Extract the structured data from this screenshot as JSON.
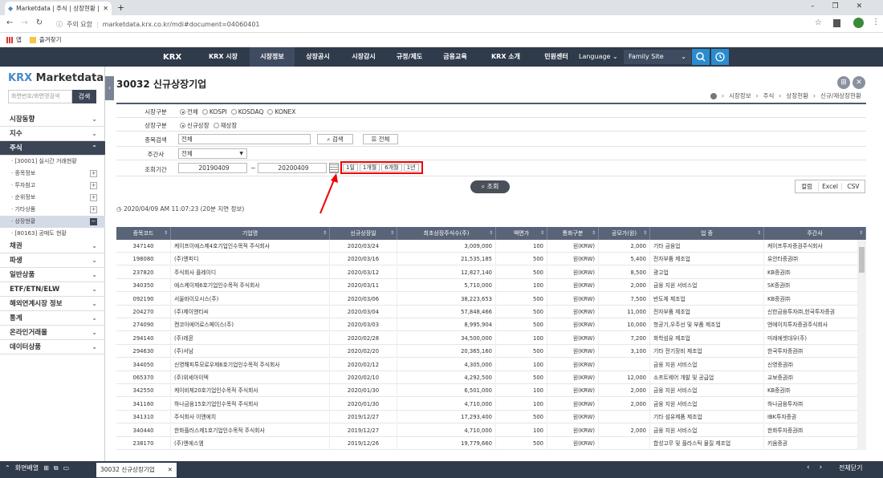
{
  "browser": {
    "tab_title": "Marketdata | 주식 | 상장현황 | 전",
    "security_label": "주의 요함",
    "url": "marketdata.krx.co.kr/mdi#document=04060401",
    "bookmarks": [
      "앱",
      "즐겨찾기"
    ]
  },
  "topnav": {
    "logo": "KRX",
    "items": [
      "KRX 시장",
      "시장정보",
      "상장공시",
      "시장감시",
      "규정/제도",
      "금융교육",
      "KRX 소개",
      "민원센터"
    ],
    "language": "Language",
    "family_site": "Family Site"
  },
  "sidebar": {
    "brand_prefix": "KRX",
    "brand_suffix": "Marketdata",
    "search_placeholder": "화면번호/화면명검색",
    "search_button": "검색",
    "menu": [
      "시장동향",
      "지수",
      "주식",
      "채권",
      "파생",
      "일반상품",
      "ETF/ETN/ELW",
      "해외연계시장 정보",
      "통계",
      "온라인거래몰",
      "데이터상품"
    ],
    "submenu": [
      "· [30001] 실시간 거래현황",
      "· 종목정보",
      "· 투자참고",
      "· 순위정보",
      "· 기타상품",
      "· 상장현황",
      "· [80163] 공매도 현황"
    ]
  },
  "page": {
    "title": "30032 신규상장기업",
    "breadcrumb": [
      "시장정보",
      "주식",
      "상장현황",
      "신규/재상장현황"
    ]
  },
  "form": {
    "market_label": "시장구분",
    "market_options": [
      "전체",
      "KOSPI",
      "KOSDAQ",
      "KONEX"
    ],
    "listing_label": "상장구분",
    "listing_options": [
      "신규상장",
      "재상장"
    ],
    "issue_label": "종목검색",
    "issue_value": "전체",
    "search_btn": "검색",
    "all_btn": "전체",
    "underwriter_label": "주간사",
    "underwriter_value": "전체",
    "period_label": "조회기간",
    "date_from": "20190409",
    "tilde": "~",
    "date_to": "20200409",
    "period_buttons": [
      "1일",
      "1개월",
      "6개월",
      "1년"
    ],
    "query_btn": "조회",
    "download": [
      "컬럼",
      "Excel",
      "CSV"
    ],
    "timestamp": "2020/04/09 AM 11:07:23 (20분 지연 정보)"
  },
  "table": {
    "headers": [
      "종목코드",
      "기업명",
      "신규상장일",
      "최초상장주식수(주)",
      "액면가",
      "통화구분",
      "공모가(원)",
      "업 종",
      "주간사"
    ],
    "rows": [
      [
        "347140",
        "케이프이에스제4호기업인수목적 주식회사",
        "2020/03/24",
        "3,009,000",
        "100",
        "원(KRW)",
        "2,000",
        "기타 금융업",
        "케이프투자증권주식회사"
      ],
      [
        "198080",
        "(주)엔피디",
        "2020/03/16",
        "21,535,185",
        "500",
        "원(KRW)",
        "5,400",
        "전자부품 제조업",
        "유안타증권㈜"
      ],
      [
        "237820",
        "주식회사 플레이디",
        "2020/03/12",
        "12,827,140",
        "500",
        "원(KRW)",
        "8,500",
        "광고업",
        "KB증권㈜"
      ],
      [
        "340350",
        "에스케이제6호기업인수목적 주식회사",
        "2020/03/11",
        "5,710,000",
        "100",
        "원(KRW)",
        "2,000",
        "금융 지원 서비스업",
        "SK증권㈜"
      ],
      [
        "092190",
        "서울바이오시스(주)",
        "2020/03/06",
        "38,223,653",
        "500",
        "원(KRW)",
        "7,500",
        "반도체 제조업",
        "KB증권㈜"
      ],
      [
        "204270",
        "(주)제이앤티씨",
        "2020/03/04",
        "57,848,466",
        "500",
        "원(KRW)",
        "11,000",
        "전자부품 제조업",
        "신한금융투자㈜,한국투자증권"
      ],
      [
        "274090",
        "켄코아에어로스페이스(주)",
        "2020/03/03",
        "8,995,904",
        "500",
        "원(KRW)",
        "10,000",
        "항공기,우주선 및 부품 제조업",
        "엔에이치투자증권주식회사"
      ],
      [
        "294140",
        "(주)레몬",
        "2020/02/28",
        "34,500,000",
        "100",
        "원(KRW)",
        "7,200",
        "화학섬유 제조업",
        "미래에셋대우(주)"
      ],
      [
        "294630",
        "(주)서남",
        "2020/02/20",
        "20,365,160",
        "500",
        "원(KRW)",
        "3,100",
        "기타 전기장비 제조업",
        "한국투자증권㈜"
      ],
      [
        "344050",
        "신영해피투모로우제6호기업인수목적 주식회사",
        "2020/02/12",
        "4,305,000",
        "100",
        "원(KRW)",
        "",
        "금융 지원 서비스업",
        "신영증권㈜"
      ],
      [
        "065370",
        "(주)위세아이텍",
        "2020/02/10",
        "4,292,500",
        "500",
        "원(KRW)",
        "12,000",
        "소프트웨어 개발 및 공급업",
        "교보증권㈜"
      ],
      [
        "342550",
        "케이비제20호기업인수목적 주식회사",
        "2020/01/30",
        "6,501,000",
        "100",
        "원(KRW)",
        "2,000",
        "금융 지원 서비스업",
        "KB증권㈜"
      ],
      [
        "341160",
        "하나금융15호기업인수목적 주식회사",
        "2020/01/30",
        "4,710,000",
        "100",
        "원(KRW)",
        "2,000",
        "금융 지원 서비스업",
        "하나금융투자㈜"
      ],
      [
        "341310",
        "주식회사 이앤에치",
        "2019/12/27",
        "17,293,400",
        "500",
        "원(KRW)",
        "",
        "기타 섬유제품 제조업",
        "IBK투자증권"
      ],
      [
        "340440",
        "한화플러스제1호기업인수목적 주식회사",
        "2019/12/27",
        "4,710,000",
        "100",
        "원(KRW)",
        "2,000",
        "금융 지원 서비스업",
        "한화투자증권㈜"
      ],
      [
        "238170",
        "(주)엔에스엠",
        "2019/12/26",
        "19,779,660",
        "500",
        "원(KRW)",
        "",
        "합성고무 및 플라스틱 물질 제조업",
        "키움증권"
      ]
    ]
  },
  "bottom": {
    "layout_label": "화면배열",
    "window_tab": "30032 신규상장기업",
    "close_all": "전체닫기"
  }
}
